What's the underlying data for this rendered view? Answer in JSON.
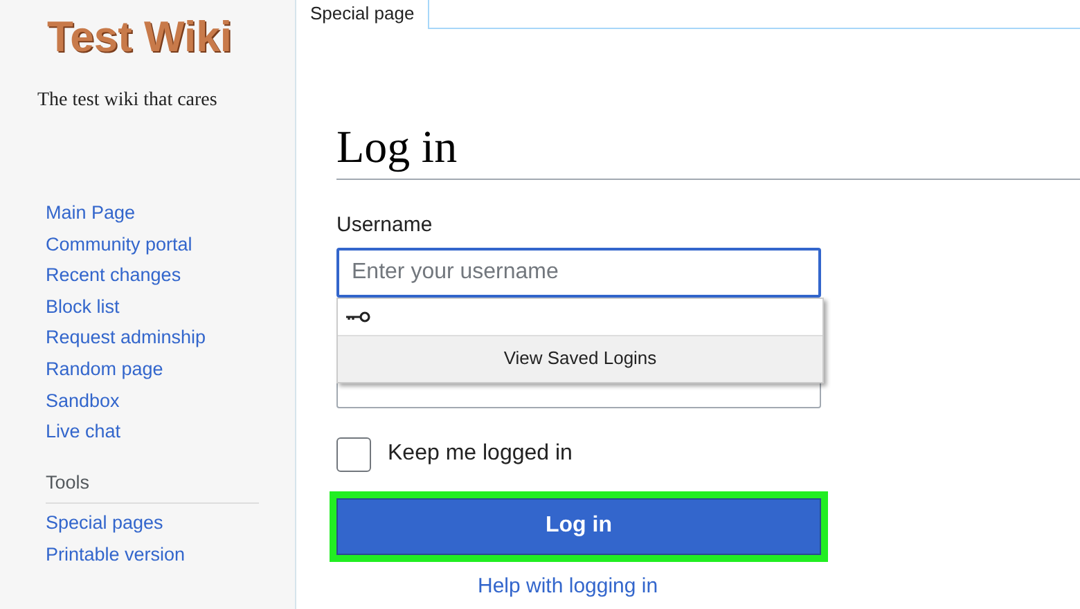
{
  "logo": {
    "text": "Test Wiki"
  },
  "tagline": "The test wiki that cares",
  "navigation": [
    {
      "label": "Main Page"
    },
    {
      "label": "Community portal"
    },
    {
      "label": "Recent changes"
    },
    {
      "label": "Block list"
    },
    {
      "label": "Request adminship"
    },
    {
      "label": "Random page"
    },
    {
      "label": "Sandbox"
    },
    {
      "label": "Live chat"
    }
  ],
  "tools": {
    "heading": "Tools",
    "items": [
      {
        "label": "Special pages"
      },
      {
        "label": "Printable version"
      }
    ]
  },
  "tabs": [
    {
      "label": "Special page",
      "selected": true
    }
  ],
  "heading": "Log in",
  "username": {
    "label": "Username",
    "placeholder": "Enter your username"
  },
  "autofill": {
    "button": "View Saved Logins"
  },
  "keep_logged_in": {
    "label": "Keep me logged in",
    "checked": false
  },
  "login_button": {
    "label": "Log in",
    "highlighted": true
  },
  "help_link": "Help with logging in"
}
